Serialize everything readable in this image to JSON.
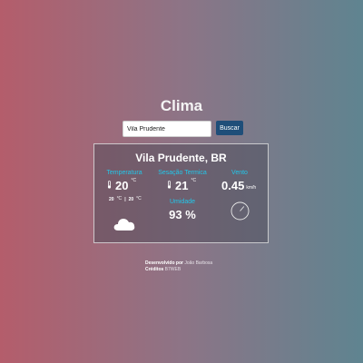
{
  "app": {
    "title": "Clima"
  },
  "search": {
    "value": "Vila Prudente",
    "button_label": "Buscar"
  },
  "weather": {
    "location": "Vila Prudente, BR",
    "temperature": {
      "label": "Temperatura",
      "value": "20",
      "unit": "°C",
      "min": "20",
      "min_unit": "°C",
      "separator": "|",
      "max": "20",
      "max_unit": "°C"
    },
    "feels_like": {
      "label": "Sesação Termica",
      "value": "21",
      "unit": "°C"
    },
    "wind": {
      "label": "Vento",
      "value": "0.45",
      "unit": "km/h"
    },
    "humidity": {
      "label": "Umidade",
      "value": "93 %"
    },
    "condition_icon": "cloud-icon",
    "wind_direction_icon": "compass-icon"
  },
  "footer": {
    "developed_label": "Desenvolvido por",
    "developer": "João Barbosa",
    "credits_label": "Créditos",
    "credits": "B7WEB"
  },
  "colors": {
    "gradient_left": "#b45d6b",
    "gradient_right": "#5f8490",
    "accent": "#22c7ea",
    "button": "#1f4e79"
  }
}
